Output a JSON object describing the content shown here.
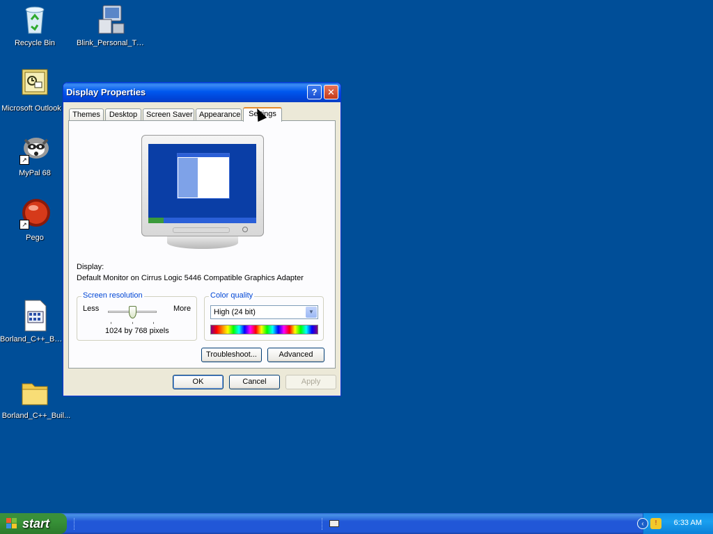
{
  "desktop": {
    "icons": [
      {
        "label": "Recycle Bin",
        "icon": "recycle-bin-icon"
      },
      {
        "label": "Blink_Personal_Trial",
        "icon": "computer-icon"
      },
      {
        "label": "Microsoft Outlook",
        "icon": "outlook-icon"
      },
      {
        "label": "MyPal 68",
        "icon": "raccoon-icon"
      },
      {
        "label": "Pego",
        "icon": "red-orb-icon"
      },
      {
        "label": "Borland_C++_Bui...",
        "icon": "document-icon"
      },
      {
        "label": "Borland_C++_Buil...",
        "icon": "folder-icon"
      }
    ]
  },
  "window": {
    "title": "Display Properties",
    "help_label": "?",
    "close_label": "✕",
    "tabs": [
      {
        "label": "Themes"
      },
      {
        "label": "Desktop"
      },
      {
        "label": "Screen Saver"
      },
      {
        "label": "Appearance"
      },
      {
        "label": "Settings",
        "active": true
      }
    ],
    "display_label": "Display:",
    "display_value": "Default Monitor on Cirrus Logic 5446 Compatible Graphics Adapter",
    "resolution": {
      "title": "Screen resolution",
      "less": "Less",
      "more": "More",
      "value_text": "1024 by 768 pixels",
      "slider_level_percent": 50
    },
    "color": {
      "title": "Color quality",
      "selected": "High (24 bit)"
    },
    "buttons": {
      "troubleshoot": "Troubleshoot...",
      "advanced": "Advanced",
      "ok": "OK",
      "cancel": "Cancel",
      "apply": "Apply"
    }
  },
  "taskbar": {
    "start_label": "start",
    "clock": "6:33 AM"
  },
  "colors": {
    "desktop": "#004e98",
    "titlebar": "#0058ee",
    "active_tab_accent": "#e68b2c",
    "group_title": "#0046d5"
  }
}
